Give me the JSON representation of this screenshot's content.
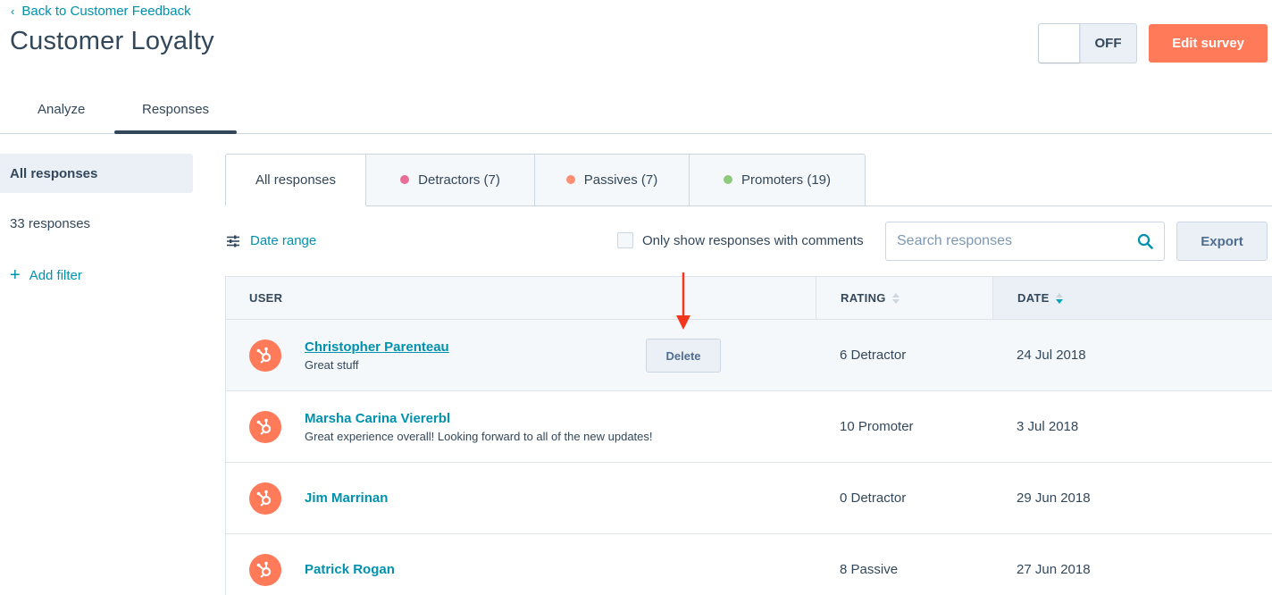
{
  "header": {
    "back_label": "Back to Customer Feedback",
    "title": "Customer Loyalty",
    "toggle_label": "OFF",
    "edit_label": "Edit survey"
  },
  "page_tabs": {
    "analyze": "Analyze",
    "responses": "Responses",
    "active": "responses"
  },
  "sidebar": {
    "active_label": "All responses",
    "count_label": "33 responses",
    "add_filter": "Add filter"
  },
  "segments": [
    {
      "label": "All responses",
      "color": null,
      "active": true
    },
    {
      "label": "Detractors (7)",
      "color": "#e66e97"
    },
    {
      "label": "Passives (7)",
      "color": "#ff8f73"
    },
    {
      "label": "Promoters (19)",
      "color": "#8fc97c"
    }
  ],
  "toolbar": {
    "date_range": "Date range",
    "only_comments": "Only show responses with comments",
    "search_placeholder": "Search responses",
    "export": "Export"
  },
  "table": {
    "headers": {
      "user": "USER",
      "rating": "RATING",
      "date": "DATE"
    },
    "sort_column": "date",
    "rows": [
      {
        "name": "Christopher Parenteau",
        "comment": "Great stuff",
        "rating": "6 Detractor",
        "date": "24 Jul 2018",
        "hover": true,
        "delete_label": "Delete"
      },
      {
        "name": "Marsha Carina Viererbl",
        "comment": "Great experience overall! Looking forward to all of the new updates!",
        "rating": "10 Promoter",
        "date": "3 Jul 2018"
      },
      {
        "name": "Jim Marrinan",
        "comment": "",
        "rating": "0 Detractor",
        "date": "29 Jun 2018"
      },
      {
        "name": "Patrick Rogan",
        "comment": "",
        "rating": "8 Passive",
        "date": "27 Jun 2018"
      }
    ]
  },
  "colors": {
    "accent": "#0091ae",
    "primary_button": "#ff7a59",
    "annotation_arrow": "#f2371e",
    "text": "#33475b"
  }
}
